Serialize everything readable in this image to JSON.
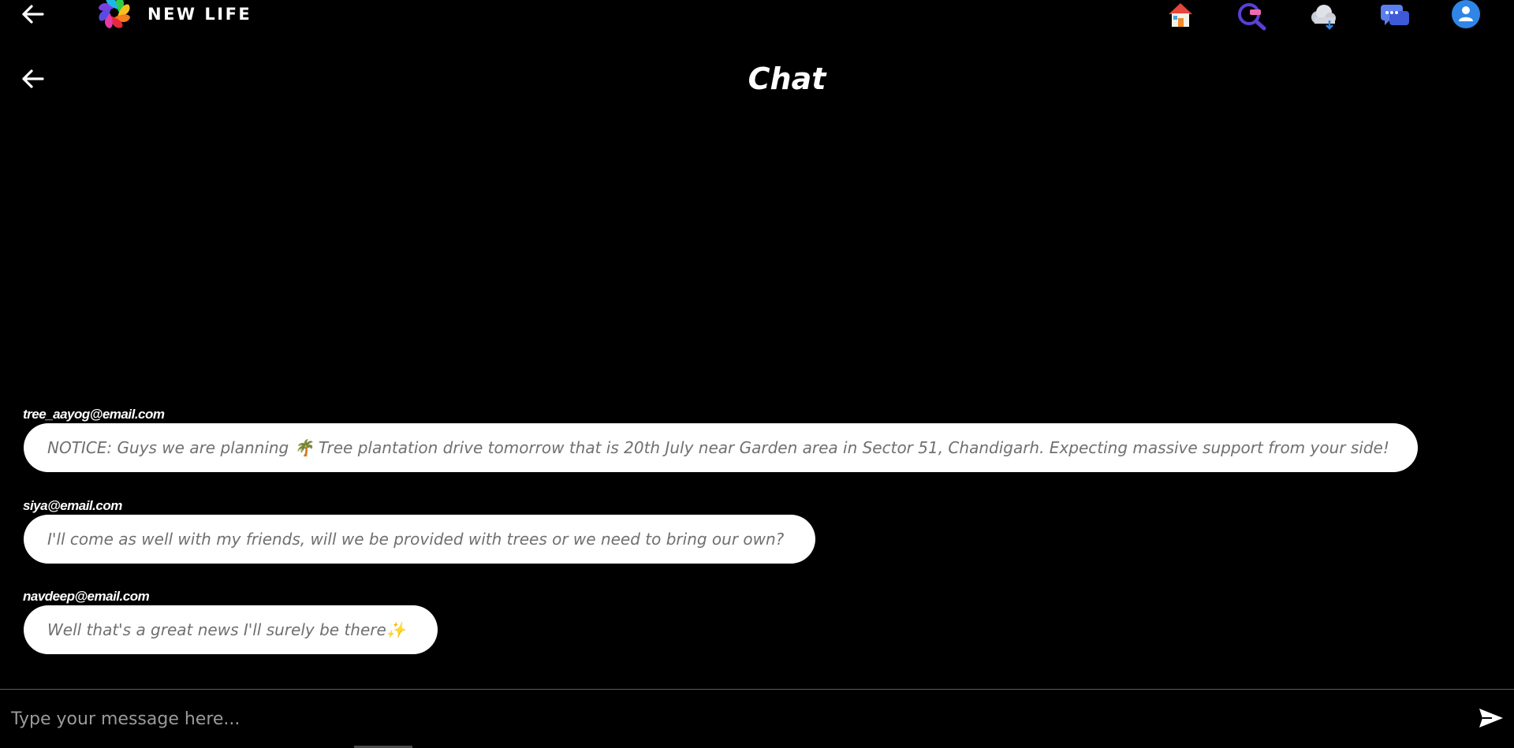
{
  "app": {
    "brand": "NEW LIFE"
  },
  "nav": {
    "items": [
      {
        "name": "home-icon"
      },
      {
        "name": "search-icon"
      },
      {
        "name": "cloud-icon"
      },
      {
        "name": "chat-icon"
      },
      {
        "name": "profile-icon"
      }
    ]
  },
  "chat": {
    "title": "Chat",
    "messages": [
      {
        "sender": "tree_aayog@email.com",
        "text": "NOTICE: Guys we are planning 🌴 Tree plantation drive tomorrow that is 20th July near  Garden area in Sector 51, Chandigarh. Expecting massive support from your side!"
      },
      {
        "sender": "siya@email.com",
        "text": "I'll come as well with my friends, will we be provided with trees or we need to bring our own?"
      },
      {
        "sender": "navdeep@email.com",
        "text": "Well that's a great news I'll surely be there✨"
      }
    ]
  },
  "composer": {
    "placeholder": "Type your message here...",
    "value": ""
  },
  "colors": {
    "background": "#000000",
    "bubble": "#ffffff",
    "bubble_text": "#707070",
    "accent_blue": "#2f86e6",
    "search_purple": "#5b3fd6"
  }
}
